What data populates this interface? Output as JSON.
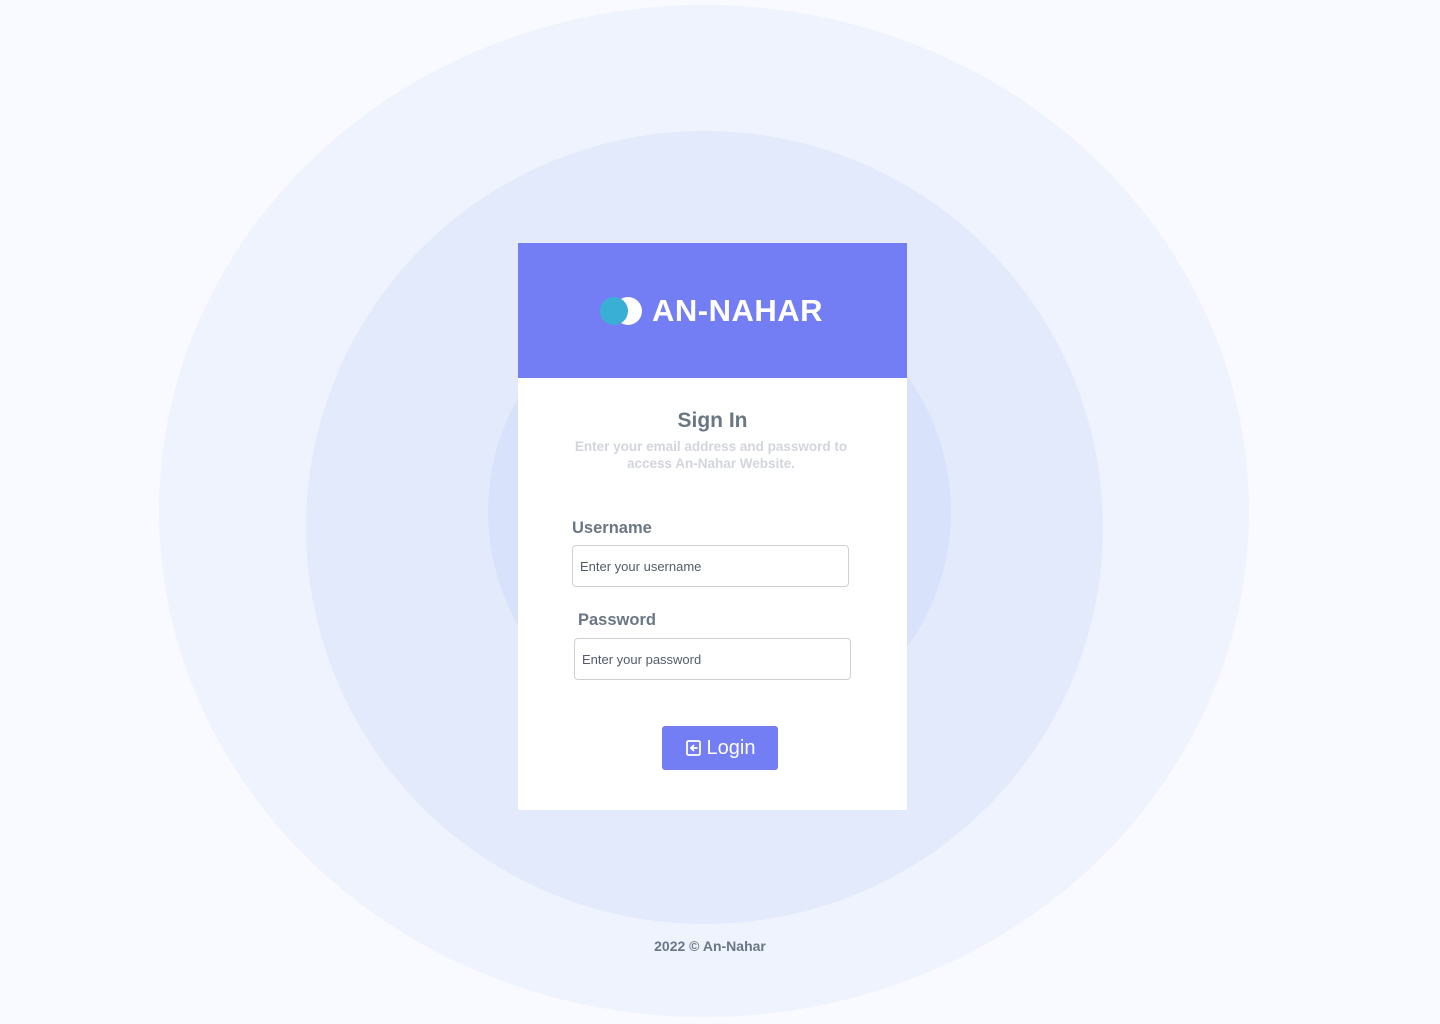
{
  "brand": {
    "name": "AN-NAHAR",
    "logo_icon": "two-circles-logo-icon",
    "colors": {
      "header": "#737df4",
      "logo_accent": "#3aafd6"
    }
  },
  "form": {
    "title": "Sign In",
    "subtitle": "Enter your email address and password to access An-Nahar Website.",
    "username_label": "Username",
    "username_placeholder": "Enter your username",
    "username_value": "",
    "password_label": "Password",
    "password_placeholder": "Enter your password",
    "password_value": "",
    "login_label": "Login",
    "login_icon": "login-icon"
  },
  "footer": {
    "text": "2022 © An-Nahar"
  }
}
